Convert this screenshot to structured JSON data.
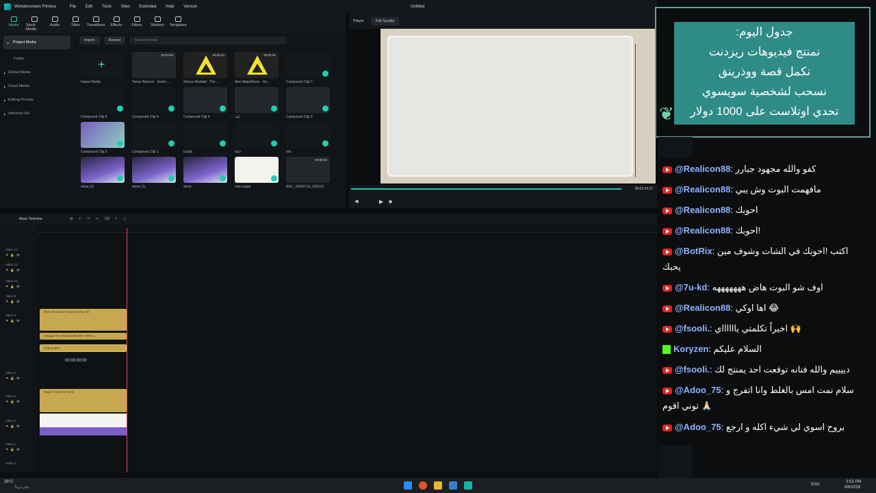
{
  "app": {
    "name": "Wonderscreen Filmora",
    "window_title": "Untitled",
    "menu": [
      "File",
      "Edit",
      "Tools",
      "View",
      "Extended",
      "Help",
      "Version"
    ]
  },
  "toolbar": {
    "items": [
      "Media",
      "Stock Media",
      "Audio",
      "Titles",
      "Transitions",
      "Effects",
      "Filters",
      "Stickers",
      "Templates"
    ]
  },
  "left_nav": {
    "items": [
      "Project Media",
      "Folder",
      "Global Media",
      "Cloud Media",
      "Editing Presets",
      "Influence Kit"
    ]
  },
  "media_toolbar": {
    "import": "Import",
    "record": "Record",
    "search_placeholder": "Search media"
  },
  "media": [
    {
      "name": "Import Media",
      "duration": ""
    },
    {
      "name": "Tomer Banuch - Some ...",
      "duration": "00:02:50"
    },
    {
      "name": "Steven Beddall - The ...",
      "duration": "00:02:44"
    },
    {
      "name": "Alex MakeMusic - Go...",
      "duration": "00:02:01"
    },
    {
      "name": "Compound Clip 7",
      "duration": ""
    },
    {
      "name": "Compound Clip 6",
      "duration": ""
    },
    {
      "name": "Compound Clip 5",
      "duration": ""
    },
    {
      "name": "Compound Clip 4",
      "duration": ""
    },
    {
      "name": "ليك",
      "duration": ""
    },
    {
      "name": "Compound Clip 3",
      "duration": ""
    },
    {
      "name": "Compound Clip 2",
      "duration": ""
    },
    {
      "name": "Compound Clip 1",
      "duration": ""
    },
    {
      "name": "lucilla",
      "duration": ""
    },
    {
      "name": "lucy",
      "duration": ""
    },
    {
      "name": "reb",
      "duration": ""
    },
    {
      "name": "show (2)",
      "duration": ""
    },
    {
      "name": "show (1)",
      "duration": ""
    },
    {
      "name": "show",
      "duration": ""
    },
    {
      "name": "note paper",
      "duration": ""
    },
    {
      "name": "REC_20260710_005122",
      "duration": "00:00:02"
    }
  ],
  "player": {
    "label": "Player",
    "quality": "Full Quality",
    "timecode": "00:03:34:27"
  },
  "timeline": {
    "label": "Main Timeline",
    "current_time": "00:00:00:00"
  },
  "tracks": [
    {
      "label": "Video 12"
    },
    {
      "label": "Video 11"
    },
    {
      "label": "Video 10"
    },
    {
      "label": "Video 9"
    },
    {
      "label": "Video 6"
    },
    {
      "label": "Video 4"
    },
    {
      "label": "Video 3"
    },
    {
      "label": "Video 2"
    },
    {
      "label": "Video 1"
    },
    {
      "label": "Audio 1"
    }
  ],
  "clips": [
    {
      "name": "Retro Polaroid Frame Overlay 02"
    },
    {
      "name": "Vintage Film Pack 8MM DIRT ORGA..."
    },
    {
      "name": "Grainy Blur"
    },
    {
      "name": "Paper Crinkle 02 16:9"
    }
  ],
  "schedule": {
    "lines": [
      "جدول اليوم:",
      "نمنتج فيديوهات ريزدنت",
      "نكمل قصة ووذرينق",
      "نسحب لشخصية سويسوي",
      "تحدي اوتلاست على 1000 دولار"
    ]
  },
  "chat": [
    {
      "platform": "youtube",
      "user": "@Realicon88",
      "text": "كفو والله مجهود جبارر"
    },
    {
      "platform": "youtube",
      "user": "@Realicon88",
      "text": "مافهمت البوت وش يبي"
    },
    {
      "platform": "youtube",
      "user": "@Realicon88",
      "text": "احوبك"
    },
    {
      "platform": "youtube",
      "user": "@Realicon88",
      "text": "احوبك!"
    },
    {
      "platform": "youtube",
      "user": "@BotRix",
      "text": "اكتب !احوبك في الشات وشوف مين يحبك"
    },
    {
      "platform": "youtube",
      "user": "@7u-kd",
      "text": "اوف شو البوت هاض هههههههه"
    },
    {
      "platform": "youtube",
      "user": "@Realicon88",
      "text": "اها اوكي 😂"
    },
    {
      "platform": "youtube",
      "user": "@fsooli.",
      "text": "اخيراً تكلمتي يااااااي 🙌"
    },
    {
      "platform": "kick",
      "user": "Koryzen",
      "text": "السلام عليكم"
    },
    {
      "platform": "youtube",
      "user": "@fsooli.",
      "text": "دييييم والله فنانه توقعت احد يمنتج لك"
    },
    {
      "platform": "youtube",
      "user": "@Adoo_75",
      "text": "سلام نمت امس بالغلط وانا اتفرج و توني اقوم 🙏🏻"
    },
    {
      "platform": "youtube",
      "user": "@Adoo_75",
      "text": "بروح اسوي لي شيء اكله و ارجع"
    }
  ],
  "taskbar": {
    "weather": "38°C",
    "weather_sub": "غائم جزئياً",
    "lang": "ENG",
    "time": "3:53 PM",
    "date": "8/6/2026"
  }
}
